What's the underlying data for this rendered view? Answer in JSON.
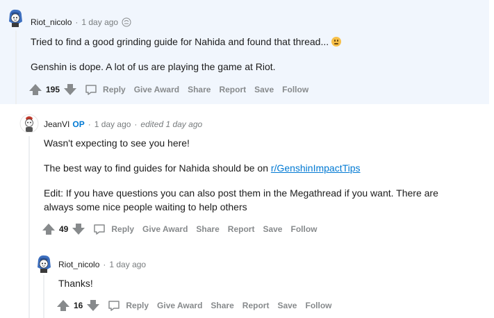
{
  "comments": [
    {
      "author": "Riot_nicolo",
      "time": "1 day ago",
      "body": [
        "Tried to find a good grinding guide for Nahida and found that thread...",
        "Genshin is dope. A lot of us are playing the game at Riot."
      ],
      "score": "195",
      "actions": [
        "Reply",
        "Give Award",
        "Share",
        "Report",
        "Save",
        "Follow"
      ]
    },
    {
      "author": "JeanVI",
      "op": "OP",
      "time": "1 day ago",
      "edited": "edited 1 day ago",
      "body_line1": "Wasn't expecting to see you here!",
      "body_line2_prefix": "The best way to find guides for Nahida should be on ",
      "body_line2_link": "r/GenshinImpactTips",
      "body_line3a": "Edit: If you have questions you can also post them in the Megathread if you want. There are",
      "body_line3b": "always some nice people waiting to help others",
      "score": "49",
      "actions": [
        "Reply",
        "Give Award",
        "Share",
        "Report",
        "Save",
        "Follow"
      ]
    },
    {
      "author": "Riot_nicolo",
      "time": "1 day ago",
      "body": "Thanks!",
      "score": "16",
      "actions": [
        "Reply",
        "Give Award",
        "Share",
        "Report",
        "Save",
        "Follow"
      ]
    }
  ],
  "colors": {
    "highlight": "#f1f6fd",
    "link": "#0079d3",
    "muted": "#878a8c"
  }
}
